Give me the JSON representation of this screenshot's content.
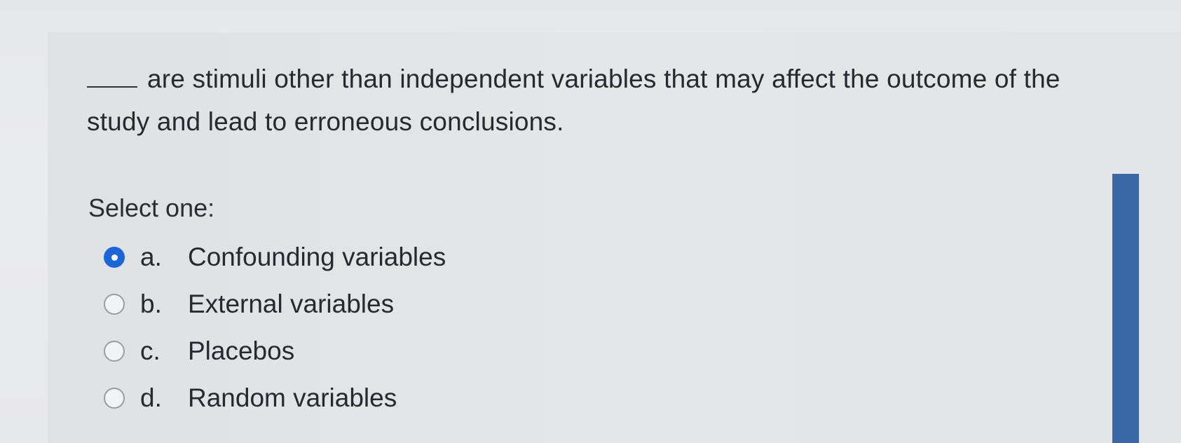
{
  "question": {
    "text": "are stimuli other than independent variables that may affect the outcome of the study and lead to erroneous conclusions."
  },
  "prompt": "Select one:",
  "options": [
    {
      "letter": "a.",
      "label": "Confounding variables",
      "selected": true
    },
    {
      "letter": "b.",
      "label": "External variables",
      "selected": false
    },
    {
      "letter": "c.",
      "label": "Placebos",
      "selected": false
    },
    {
      "letter": "d.",
      "label": "Random variables",
      "selected": false
    }
  ],
  "colors": {
    "accent": "#1a66d9",
    "sidebar": "#3a67a6",
    "text": "#262a30"
  }
}
